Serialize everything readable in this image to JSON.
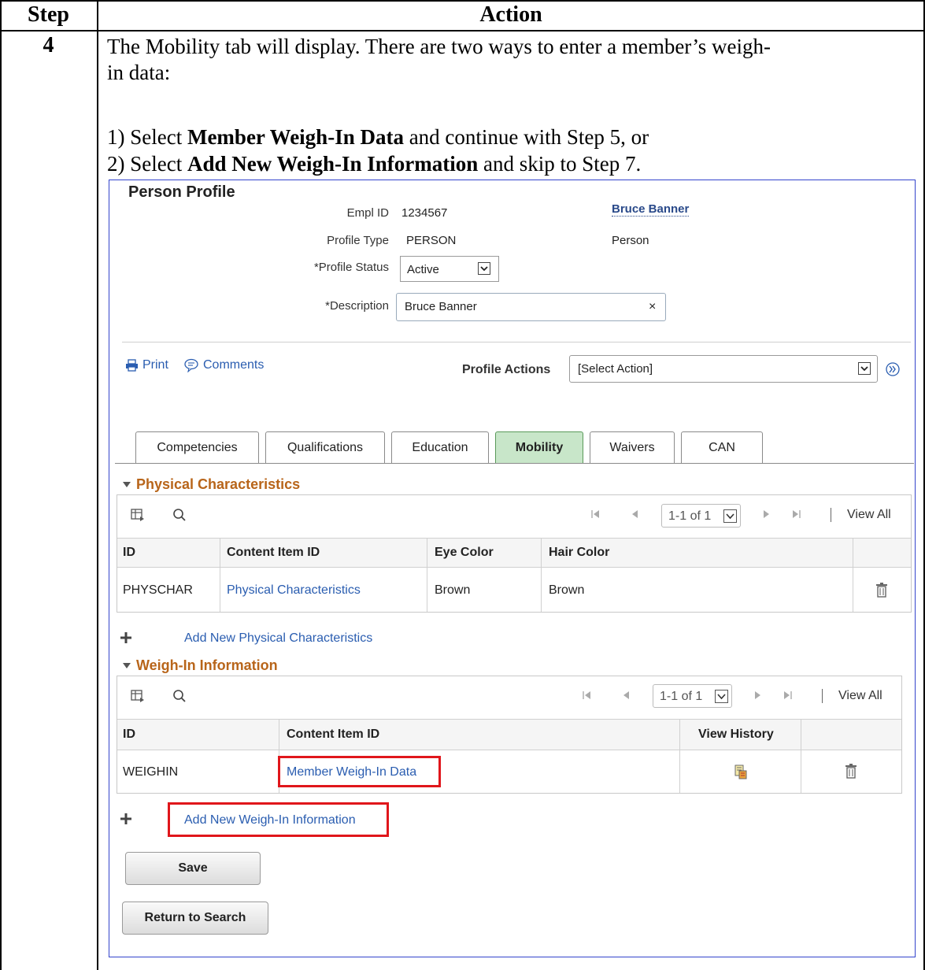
{
  "doc": {
    "header_step": "Step",
    "header_action": "Action",
    "step_number": "4",
    "line1": "The Mobility tab will display.  There are two ways to enter a member’s weigh-",
    "line2": "in data:",
    "opt1_pre": "1) Select ",
    "opt1_bold": "Member Weigh-In Data",
    "opt1_post": " and continue with Step 5, or",
    "opt2_pre": "2) Select ",
    "opt2_bold": "Add New Weigh-In Information",
    "opt2_post": " and skip to Step 7."
  },
  "profile": {
    "title": "Person Profile",
    "empl_id_label": "Empl ID",
    "empl_id_value": "1234567",
    "person_name": "Bruce Banner",
    "profile_type_label": "Profile Type",
    "profile_type_value": "PERSON",
    "profile_type_desc": "Person",
    "profile_status_label": "*Profile Status",
    "profile_status_value": "Active",
    "description_label": "*Description",
    "description_value": "Bruce Banner",
    "clear_glyph": "×",
    "print_label": "Print",
    "comments_label": "Comments",
    "profile_actions_label": "Profile Actions",
    "profile_actions_value": "[Select Action]"
  },
  "tabs": [
    {
      "label": "Competencies"
    },
    {
      "label": "Qualifications"
    },
    {
      "label": "Education"
    },
    {
      "label": "Mobility"
    },
    {
      "label": "Waivers"
    },
    {
      "label": "CAN"
    }
  ],
  "physical": {
    "section_title": "Physical Characteristics",
    "pager": "1-1 of 1",
    "view_all": "View All",
    "columns": [
      "ID",
      "Content Item ID",
      "Eye Color",
      "Hair Color"
    ],
    "row": {
      "id": "PHYSCHAR",
      "content": "Physical Characteristics",
      "eye": "Brown",
      "hair": "Brown"
    },
    "add_label": "Add New Physical Characteristics"
  },
  "weighin": {
    "section_title": "Weigh-In Information",
    "pager": "1-1 of 1",
    "view_all": "View All",
    "columns": [
      "ID",
      "Content Item ID",
      "View History"
    ],
    "row": {
      "id": "WEIGHIN",
      "content": "Member Weigh-In Data"
    },
    "add_label": "Add New Weigh-In Information"
  },
  "buttons": {
    "save": "Save",
    "return": "Return to Search"
  },
  "colors": {
    "link": "#2a5db0",
    "section": "#b8651a",
    "highlight": "#e0161b",
    "active_tab": "#c8e6c9"
  }
}
